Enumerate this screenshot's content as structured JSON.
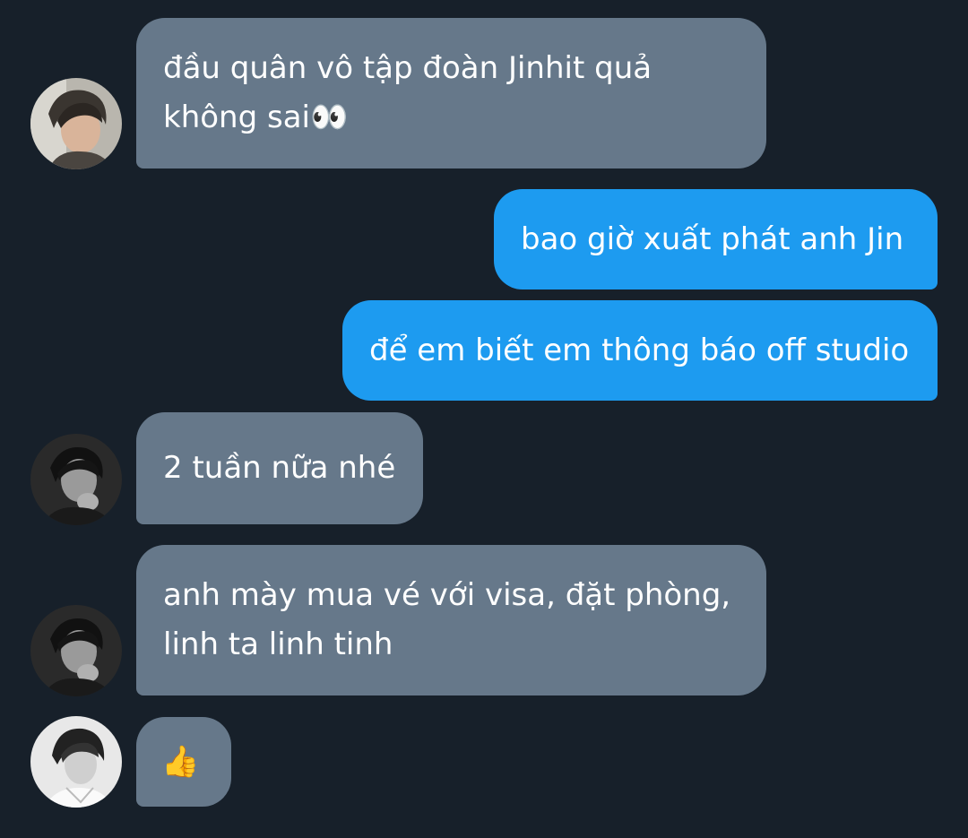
{
  "conversation": {
    "messages": [
      {
        "sender": "received",
        "avatar": "avatar-1",
        "lines": [
          "đầu quân vô tập đoàn Jinhit quả",
          "không sai👀"
        ]
      },
      {
        "sender": "sent",
        "lines": [
          "bao giờ xuất phát anh Jin"
        ]
      },
      {
        "sender": "sent",
        "lines": [
          "để em biết em thông báo off studio"
        ]
      },
      {
        "sender": "received",
        "avatar": "avatar-2",
        "lines": [
          "2 tuần nữa nhé"
        ]
      },
      {
        "sender": "received",
        "avatar": "avatar-2",
        "lines": [
          "anh mày mua vé với visa, đặt phòng,",
          "linh ta linh tinh"
        ]
      },
      {
        "sender": "received",
        "avatar": "avatar-3",
        "lines": [
          "👍"
        ]
      }
    ]
  },
  "colors": {
    "background": "#17202a",
    "received_bubble": "#66788a",
    "sent_bubble": "#1d9bf0",
    "text": "#ffffff"
  }
}
